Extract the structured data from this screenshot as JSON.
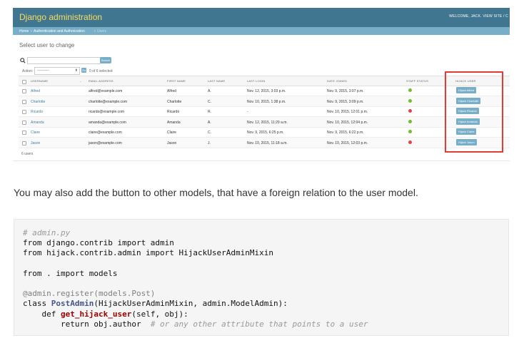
{
  "admin": {
    "title": "Django administration",
    "welcome": "WELCOME, JACK. VIEW SITE / C",
    "breadcrumb": [
      "Home",
      "Authentication and Authorization",
      "Users"
    ],
    "page_title": "Select user to change",
    "search_button": "Search",
    "actions_label": "Action:",
    "action_value": "----------",
    "go_label": "Go",
    "selected_count": "0 of 6 selected",
    "columns": [
      "USERNAME",
      "EMAIL ADDRESS",
      "FIRST NAME",
      "LAST NAME",
      "LAST LOGIN",
      "DATE JOINED",
      "STAFF STATUS",
      "HIJACK USER"
    ],
    "rows": [
      {
        "username": "Alfred",
        "email": "alfred@example.com",
        "first": "Alfred",
        "last": "A.",
        "login": "Nov. 12, 2015, 3:03 p.m.",
        "joined": "Nov. 9, 2015, 3:07 p.m.",
        "staff": true,
        "hijack": "Hijack Alfred"
      },
      {
        "username": "Charlotte",
        "email": "charlotte@example.com",
        "first": "Charlotte",
        "last": "C.",
        "login": "Nov. 10, 2015, 1:38 p.m.",
        "joined": "Nov. 9, 2015, 3:09 p.m.",
        "staff": true,
        "hijack": "Hijack Charlotte"
      },
      {
        "username": "Ricardo",
        "email": "ricardo@example.com",
        "first": "Ricardo",
        "last": "R.",
        "login": "-",
        "joined": "Nov. 10, 2015, 12:01 p.m.",
        "staff": false,
        "hijack": "Hijack Ricardo"
      },
      {
        "username": "Amanda",
        "email": "amanda@example.com",
        "first": "Amanda",
        "last": "A.",
        "login": "Nov. 12, 2015, 11:29 a.m.",
        "joined": "Nov. 10, 2015, 12:04 p.m.",
        "staff": true,
        "hijack": "Hijack Amanda"
      },
      {
        "username": "Claire",
        "email": "claire@example.com",
        "first": "Claire",
        "last": "C.",
        "login": "Nov. 9, 2015, 6:25 p.m.",
        "joined": "Nov. 9, 2015, 6:22 p.m.",
        "staff": true,
        "hijack": "Hijack Claire"
      },
      {
        "username": "Jason",
        "email": "jason@example.com",
        "first": "Jason",
        "last": "J.",
        "login": "Nov. 10, 2015, 11:18 a.m.",
        "joined": "Nov. 10, 2015, 12:03 p.m.",
        "staff": false,
        "hijack": "Hijack Jason"
      }
    ],
    "total": "6 users",
    "colors": {
      "header": "#417690",
      "brand": "#f5dd5d",
      "breadcrumb": "#79aec8",
      "link": "#447e9b",
      "highlight": "#e53935"
    }
  },
  "article": {
    "paragraph": "You may also add the button to other models, that have a foreign relation to the user model."
  },
  "code": {
    "comment1": "# admin.py",
    "line_import1": "from django.contrib import admin",
    "line_import2": "from hijack.contrib.admin import HijackUserAdminMixin",
    "line_import3": "from . import models",
    "decorator": "@admin.register(models.Post)",
    "class_kw": "class ",
    "class_name": "PostAdmin",
    "class_rest": "(HijackUserAdminMixin, admin.ModelAdmin):",
    "def_kw": "    def ",
    "func_name": "get_hijack_user",
    "func_rest": "(self, obj):",
    "return_line": "        return obj.author  ",
    "comment2": "# or any other attribute that points to a user"
  }
}
